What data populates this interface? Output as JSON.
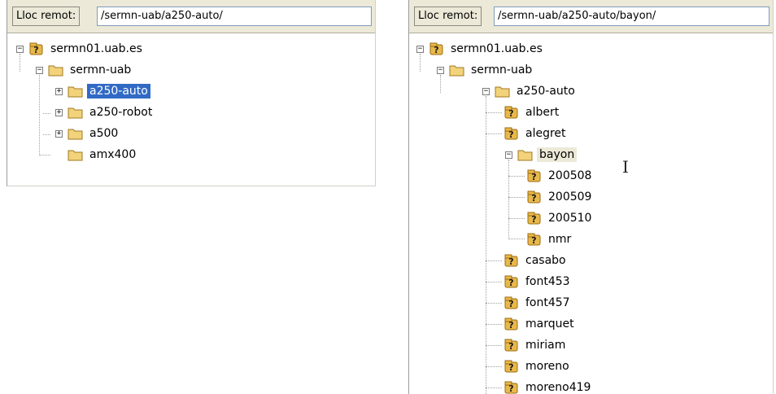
{
  "left_panel": {
    "remote_label": "Lloc remot:",
    "remote_path": "/sermn-uab/a250-auto/",
    "tree": {
      "root": "sermn01.uab.es",
      "group": "sermn-uab",
      "children": [
        "a250-auto",
        "a250-robot",
        "a500",
        "amx400"
      ],
      "selected": "a250-auto"
    }
  },
  "right_panel": {
    "remote_label": "Lloc remot:",
    "remote_path": "/sermn-uab/a250-auto/bayon/",
    "tree": {
      "root": "sermn01.uab.es",
      "group": "sermn-uab",
      "folder": "a250-auto",
      "users_before": [
        "albert",
        "alegret"
      ],
      "open_user": "bayon",
      "open_user_children": [
        "200508",
        "200509",
        "200510",
        "nmr"
      ],
      "users_after": [
        "casabo",
        "font453",
        "font457",
        "marquet",
        "miriam",
        "moreno",
        "moreno419"
      ]
    }
  },
  "colors": {
    "selection": "#316ac5",
    "toolbar": "#ece9d8",
    "folder": "#f2d27a",
    "server": "#e8b84a"
  },
  "icons": {
    "server": "unknown-server-icon",
    "folder": "folder-icon",
    "expand": "plus-box",
    "collapse": "minus-box",
    "cursor": "text-ibeam-cursor"
  }
}
